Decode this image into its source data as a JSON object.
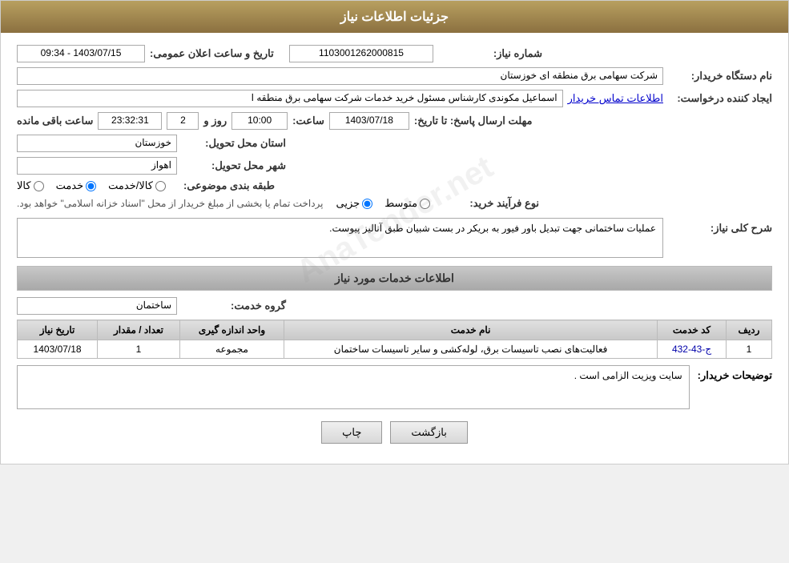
{
  "page": {
    "title": "جزئیات اطلاعات نیاز"
  },
  "header": {
    "need_number_label": "شماره نیاز:",
    "need_number_value": "1103001262000815",
    "announcement_date_label": "تاریخ و ساعت اعلان عمومی:",
    "announcement_date_value": "1403/07/15 - 09:34",
    "buyer_org_label": "نام دستگاه خریدار:",
    "buyer_org_value": "شرکت سهامی برق منطقه ای خوزستان",
    "creator_label": "ایجاد کننده درخواست:",
    "creator_name": "اسماعیل مکوندی کارشناس مسئول خرید خدمات شرکت سهامی برق منطقه ا",
    "creator_link": "اطلاعات تماس خریدار",
    "response_deadline_label": "مهلت ارسال پاسخ: تا تاریخ:",
    "response_date": "1403/07/18",
    "response_time_label": "ساعت:",
    "response_time": "10:00",
    "response_days_label": "روز و",
    "response_days": "2",
    "response_remaining_label": "ساعت باقی مانده",
    "response_remaining": "23:32:31",
    "delivery_province_label": "استان محل تحویل:",
    "delivery_province": "خوزستان",
    "delivery_city_label": "شهر محل تحویل:",
    "delivery_city": "اهواز",
    "category_label": "طبقه بندی موضوعی:",
    "category_options": [
      {
        "label": "کالا",
        "value": "kala"
      },
      {
        "label": "خدمت",
        "value": "khedmat"
      },
      {
        "label": "کالا/خدمت",
        "value": "kala_khedmat"
      }
    ],
    "category_selected": "khedmat",
    "purchase_type_label": "نوع فرآیند خرید:",
    "purchase_type_options": [
      {
        "label": "جزیی",
        "value": "jozii"
      },
      {
        "label": "متوسط",
        "value": "motavasset"
      }
    ],
    "purchase_type_selected": "jozii",
    "purchase_type_note": "پرداخت تمام یا بخشی از مبلغ خریدار از محل \"اسناد خزانه اسلامی\" خواهد بود."
  },
  "need_description": {
    "section_title": "شرح کلی نیاز:",
    "description_text": "عملیات ساختمانی جهت تبدیل باور فیور به بریکر در بست شبیان طبق آنالیز پیوست."
  },
  "services": {
    "section_title": "اطلاعات خدمات مورد نیاز",
    "service_group_label": "گروه خدمت:",
    "service_group_value": "ساختمان",
    "table_headers": {
      "row_num": "ردیف",
      "service_code": "کد خدمت",
      "service_name": "نام خدمت",
      "unit": "واحد اندازه گیری",
      "quantity": "تعداد / مقدار",
      "date": "تاریخ نیاز"
    },
    "table_rows": [
      {
        "row_num": "1",
        "service_code": "ج-43-432",
        "service_name": "فعالیت‌های نصب تاسیسات برق، لوله‌کشی و سایر تاسیسات ساختمان",
        "unit": "مجموعه",
        "quantity": "1",
        "date": "1403/07/18"
      }
    ]
  },
  "buyer_comments": {
    "label": "توضیحات خریدار:",
    "text": "سایت ویزیت الزامی است ."
  },
  "buttons": {
    "print": "چاپ",
    "back": "بازگشت"
  }
}
